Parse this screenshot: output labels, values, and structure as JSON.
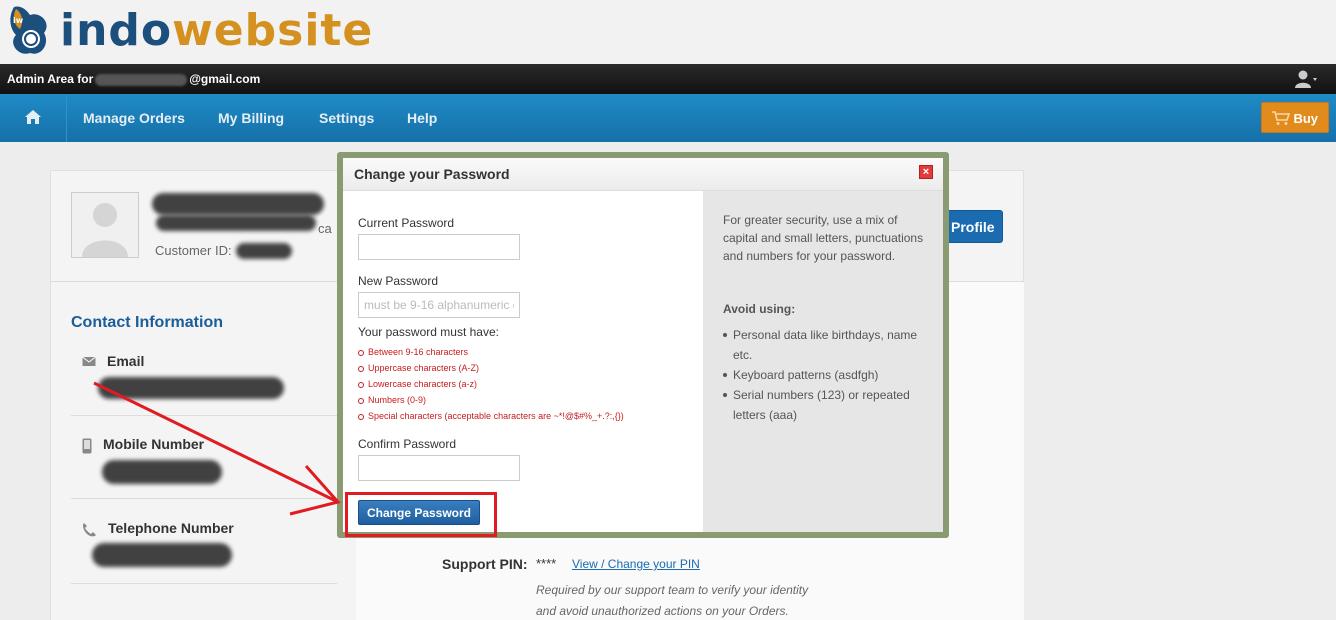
{
  "logo": {
    "prefix": "indo",
    "suffix": "website",
    "badge": "iw"
  },
  "admin_bar": {
    "prefix": "Admin Area for",
    "email_suffix": "@gmail.com"
  },
  "nav": {
    "items": [
      "Manage Orders",
      "My Billing",
      "Settings",
      "Help"
    ],
    "buy_label": "Buy"
  },
  "profile": {
    "customer_id_label": "Customer ID:",
    "profile_button": "Profile",
    "partial_text": "ca"
  },
  "contact": {
    "title": "Contact Information",
    "email_label": "Email",
    "mobile_label": "Mobile Number",
    "telephone_label": "Telephone Number"
  },
  "support": {
    "pin_label": "Support PIN:",
    "pin_value": "****",
    "pin_link": "View / Change your PIN",
    "note_line1": "Required by our support team to verify your identity",
    "note_line2": "and avoid unauthorized actions on your Orders."
  },
  "modal": {
    "title": "Change your Password",
    "close_label": "×",
    "current_label": "Current Password",
    "new_label": "New Password",
    "new_placeholder": "must be 9-16 alphanumeric c",
    "req_title": "Your password must have:",
    "requirements": [
      "Between 9-16 characters",
      "Uppercase characters (A-Z)",
      "Lowercase characters (a-z)",
      "Numbers (0-9)",
      "Special characters (acceptable characters are ~*!@$#%_+.?:,{})"
    ],
    "confirm_label": "Confirm Password",
    "submit_label": "Change Password",
    "tip": "For greater security, use a mix of capital and small letters, punctuations and numbers for your password.",
    "avoid_title": "Avoid using:",
    "avoid_items": [
      "Personal data like birthdays, name etc.",
      "Keyboard patterns (asdfgh)",
      "Serial numbers (123) or repeated letters (aaa)"
    ]
  },
  "colors": {
    "brand_blue": "#1d4f7c",
    "brand_orange": "#d4911f",
    "nav_blue": "#1f8bc6",
    "annotation_red": "#e11b22",
    "requirement_red": "#c61d1d"
  }
}
